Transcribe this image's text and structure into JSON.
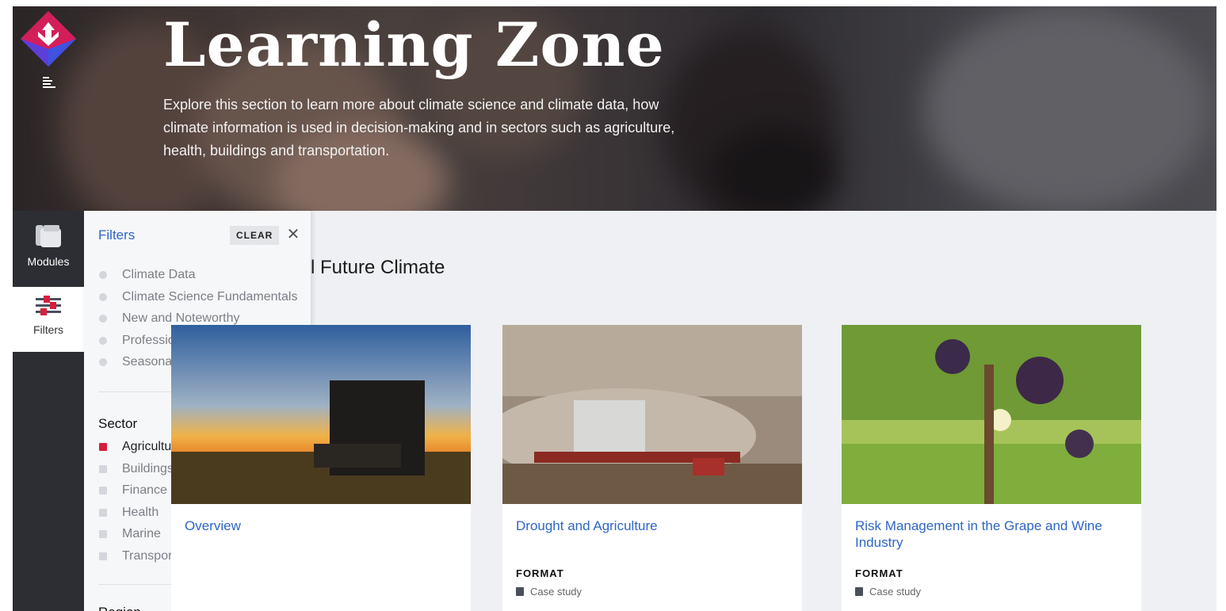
{
  "hero": {
    "title": "Learning Zone",
    "description": "Explore this section to learn more about climate science and climate data, how climate information is used in decision-making and in sectors such as agriculture, health, buildings and transportation."
  },
  "sidenav": {
    "items": [
      {
        "label": "Modules",
        "icon": "modules-icon"
      },
      {
        "label": "Filters",
        "icon": "sliders-icon"
      }
    ]
  },
  "filters": {
    "title": "Filters",
    "clear_label": "CLEAR",
    "close_icon": "close-icon",
    "topics": [
      "Climate Data",
      "Climate Science Fundamentals",
      "New and Noteworthy",
      "Professional Applications",
      "Seasonal to decadal forecasts"
    ],
    "sector_title": "Sector",
    "sectors": [
      {
        "label": "Agriculture",
        "selected": true
      },
      {
        "label": "Buildings",
        "selected": false
      },
      {
        "label": "Finance",
        "selected": false
      },
      {
        "label": "Health",
        "selected": false
      },
      {
        "label": "Marine",
        "selected": false
      },
      {
        "label": "Transportation",
        "selected": false
      }
    ],
    "region_title": "Region",
    "selected_color": "#d81e3e"
  },
  "main": {
    "heading": "l Future Climate",
    "cards": [
      {
        "title": "Overview",
        "format_label": "",
        "format_value": ""
      },
      {
        "title": "Drought and Agriculture",
        "format_label": "FORMAT",
        "format_value": "Case study"
      },
      {
        "title": "Risk Management in the Grape and Wine Industry",
        "format_label": "FORMAT",
        "format_value": "Case study"
      }
    ]
  },
  "colors": {
    "link": "#2e66c7",
    "rail": "#2c2e33",
    "background": "#eef0f4"
  }
}
